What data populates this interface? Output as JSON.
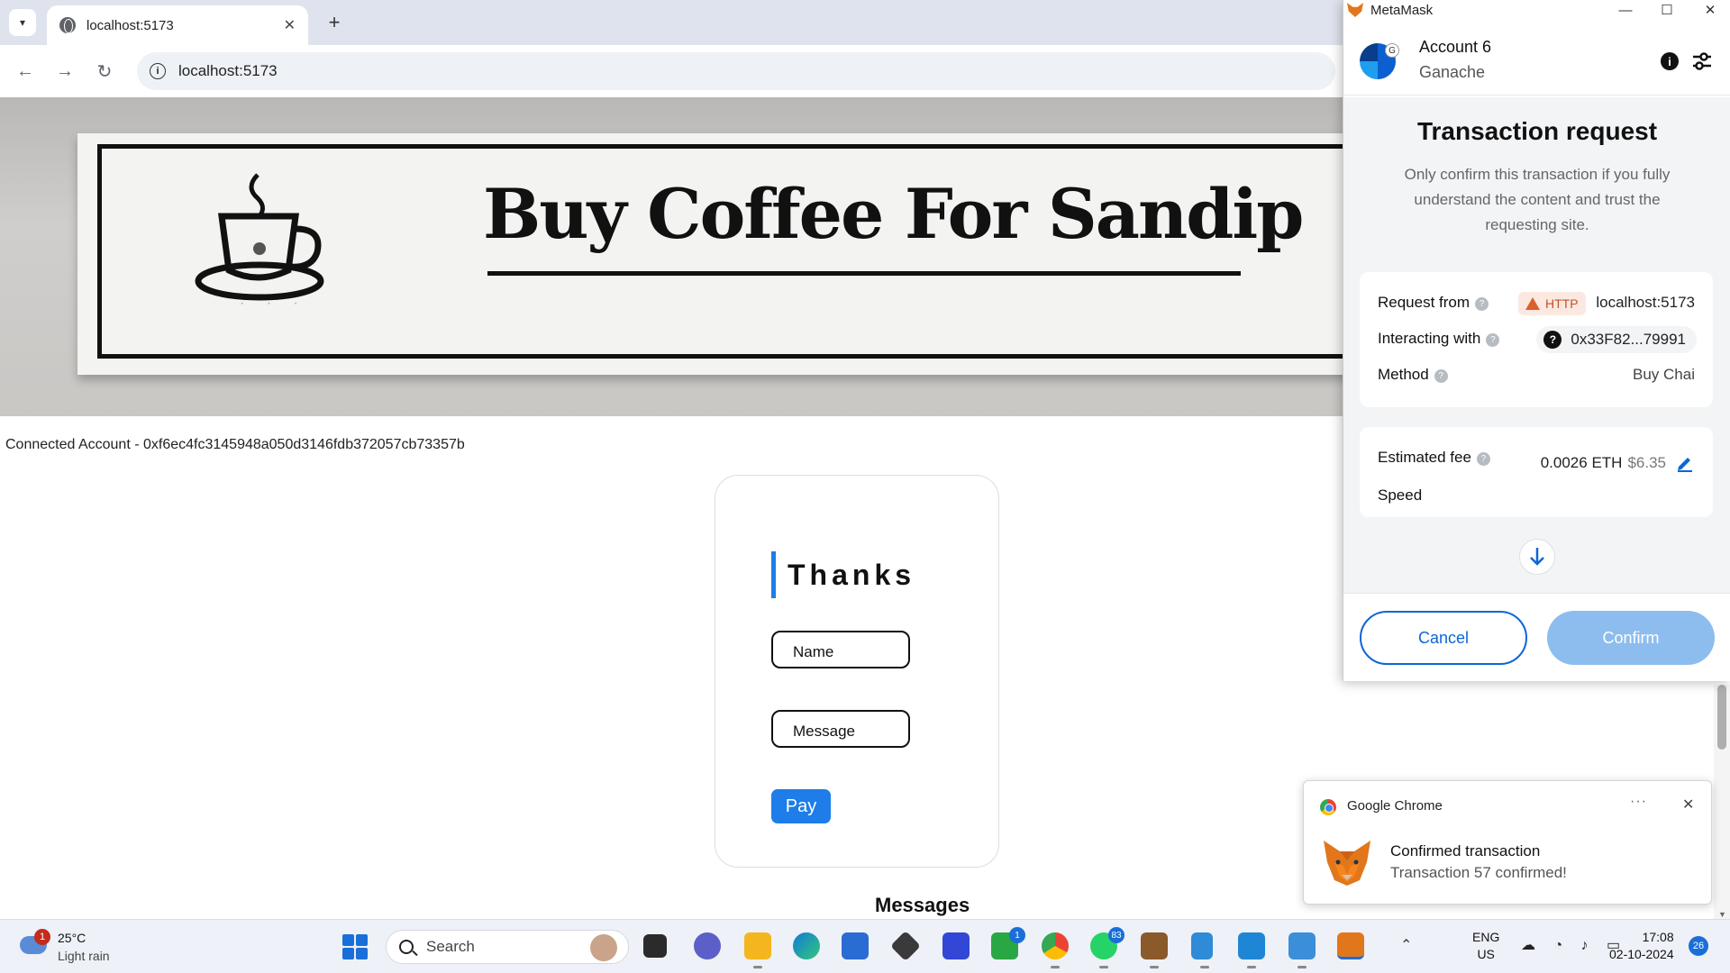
{
  "browser": {
    "tab_title": "localhost:5173",
    "new_tab_symbol": "+",
    "tab_close_symbol": "✕",
    "url": "localhost:5173"
  },
  "page": {
    "sign_title": "Buy Coffee For Sandip",
    "connected_account": "Connected Account - 0xf6ec4fc3145948a050d3146fdb372057cb73357b",
    "form": {
      "heading": "Thanks",
      "name_placeholder": "Name",
      "message_placeholder": "Message",
      "pay_label": "Pay"
    },
    "messages_title": "Messages"
  },
  "metamask": {
    "window_title": "MetaMask",
    "account_name": "Account 6",
    "network": "Ganache",
    "avatar_badge": "G",
    "title": "Transaction request",
    "subtitle": "Only confirm this transaction if you fully understand the content and trust the requesting site.",
    "request_from_label": "Request from",
    "http_badge": "HTTP",
    "request_from_value": "localhost:5173",
    "interacting_with_label": "Interacting with",
    "interacting_with_value": "0x33F82...79991",
    "method_label": "Method",
    "method_value": "Buy Chai",
    "estimated_fee_label": "Estimated fee",
    "fee_eth": "0.0026 ETH",
    "fee_usd": "$6.35",
    "speed_label": "Speed",
    "cancel_label": "Cancel",
    "confirm_label": "Confirm",
    "accent_color": "#0b66d8",
    "confirm_disabled_color": "#8cbdee"
  },
  "notification": {
    "app": "Google Chrome",
    "title": "Confirmed transaction",
    "body": "Transaction 57 confirmed!"
  },
  "taskbar": {
    "weather_badge": "1",
    "temperature": "25°C",
    "condition": "Light rain",
    "search_placeholder": "Search",
    "badges": {
      "teams": "1",
      "xbox": "1",
      "whatsapp": "83"
    },
    "lang_line1": "ENG",
    "lang_line2": "US",
    "time": "17:08",
    "date": "02-10-2024",
    "notification_count": "26"
  }
}
